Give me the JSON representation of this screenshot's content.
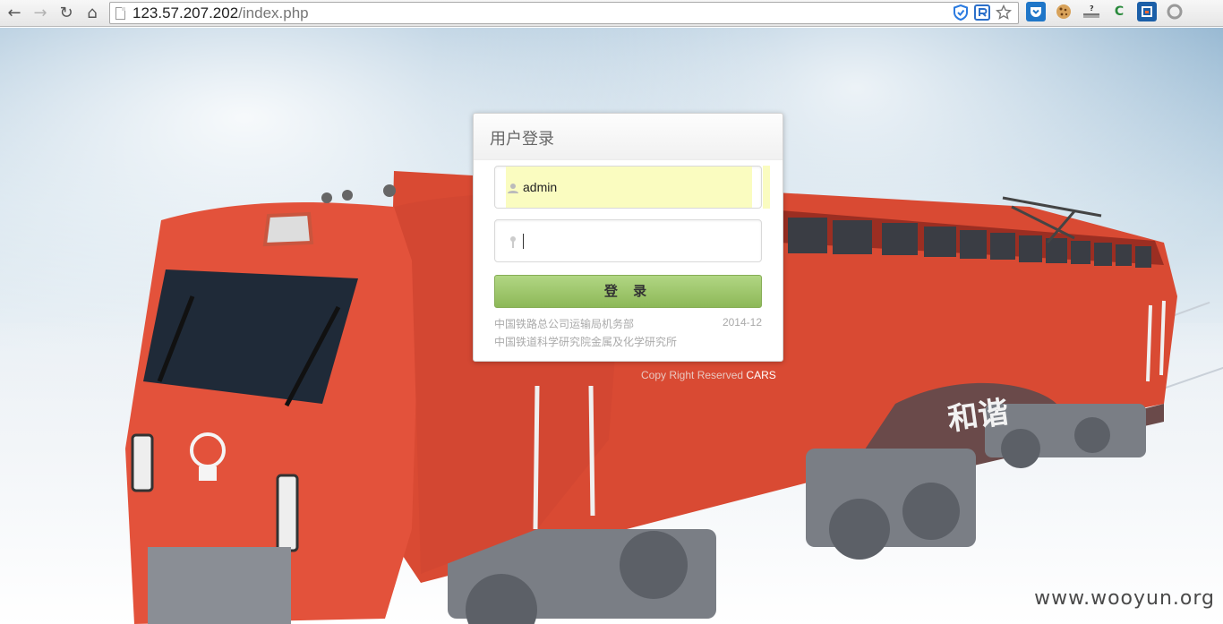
{
  "browser": {
    "url_host": "123.57.207.202",
    "url_path": "/index.php",
    "nav": {
      "back": "←",
      "forward": "→",
      "reload": "↻",
      "home": "⌂"
    }
  },
  "scene": {
    "locomotive_text": "和谐"
  },
  "login": {
    "title": "用户登录",
    "username_value": "admin",
    "password_value": "",
    "submit_label": "登 录",
    "org_line1": "中国铁路总公司运输局机务部",
    "org_date": "2014-12",
    "org_line2": "中国铁道科学研究院金属及化学研究所"
  },
  "footer": {
    "copyright_prefix": "Copy Right Reserved",
    "copyright_brand": "CARS"
  },
  "watermark": "www.wooyun.org"
}
